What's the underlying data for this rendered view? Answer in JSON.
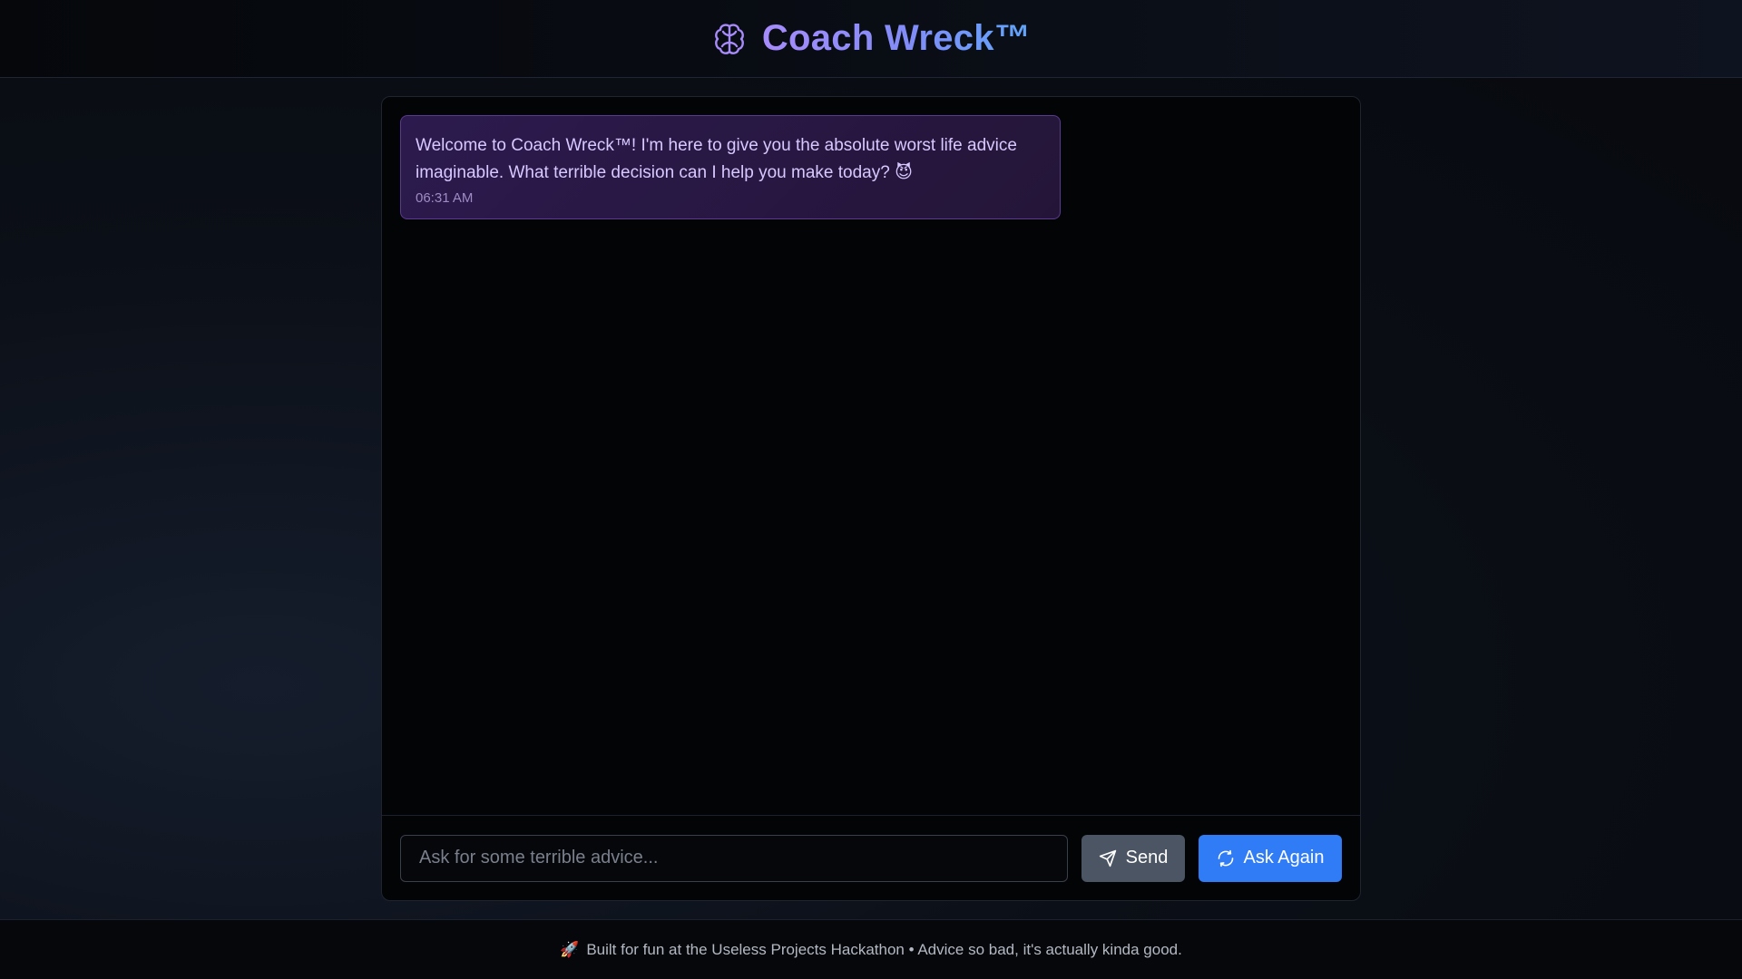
{
  "header": {
    "title": "Coach Wreck™",
    "icon": "brain-icon",
    "accent_color": "#a78bfa"
  },
  "chat": {
    "messages": [
      {
        "text": "Welcome to Coach Wreck™! I'm here to give you the absolute worst life advice imaginable. What terrible decision can I help you make today? 😈",
        "time": "06:31 AM"
      }
    ]
  },
  "input": {
    "placeholder": "Ask for some terrible advice...",
    "value": ""
  },
  "buttons": {
    "send_label": "Send",
    "send_icon": "send-icon",
    "ask_again_label": "Ask Again",
    "ask_again_icon": "refresh-icon",
    "ask_again_color": "#2f7cf6"
  },
  "footer": {
    "icon": "🚀",
    "text": "Built for fun at the Useless Projects Hackathon • Advice so bad, it's actually kinda good."
  }
}
